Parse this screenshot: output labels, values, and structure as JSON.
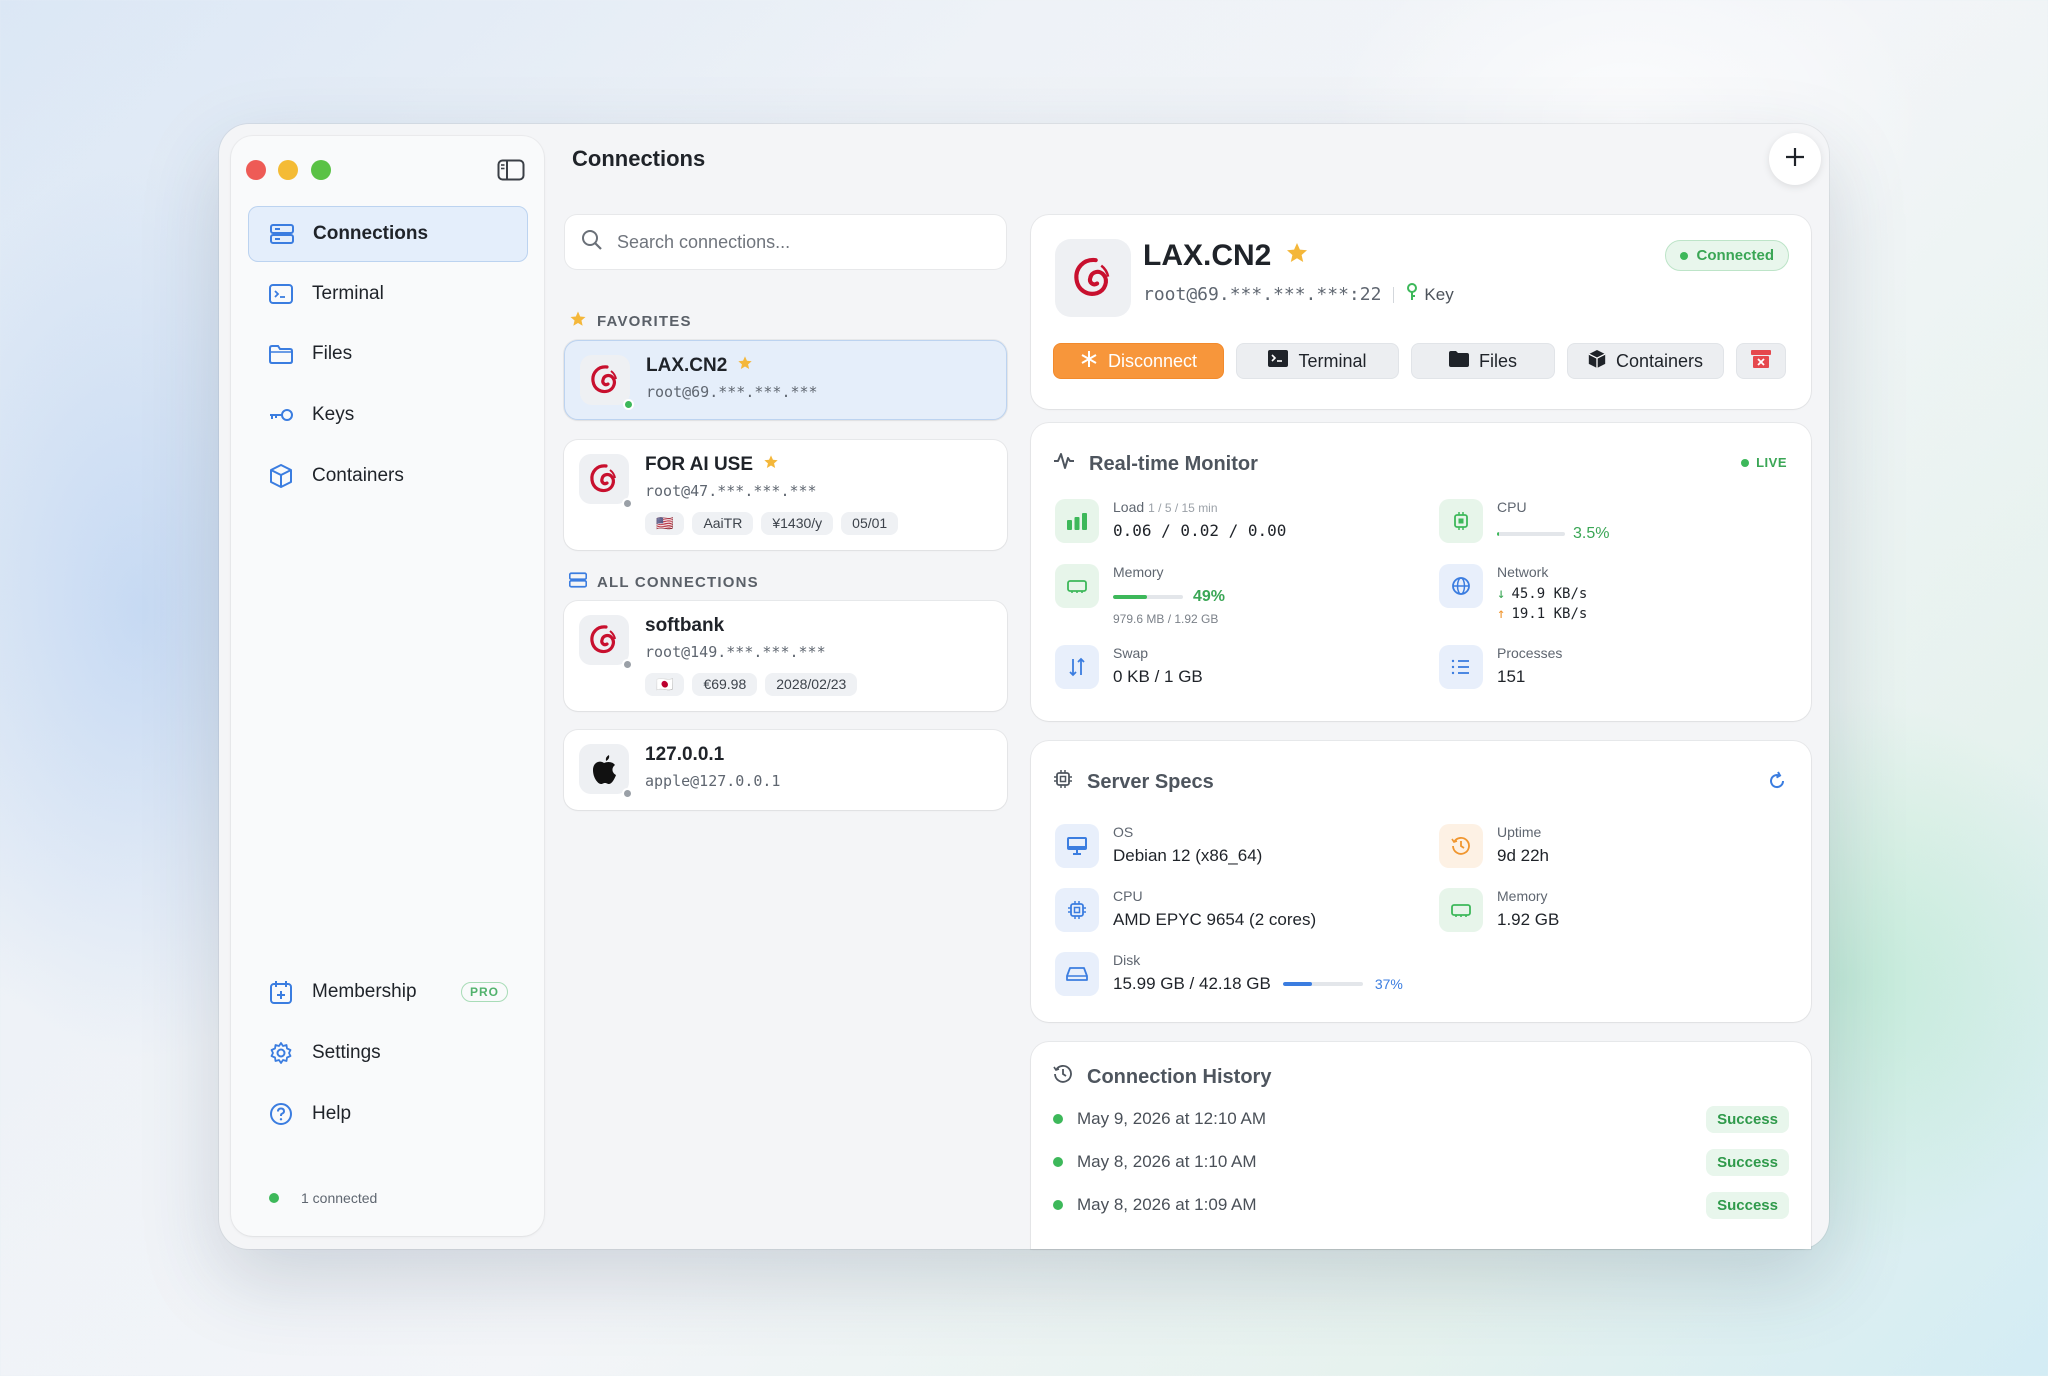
{
  "sidebar": {
    "items": [
      {
        "label": "Connections",
        "icon": "server-icon"
      },
      {
        "label": "Terminal",
        "icon": "terminal-icon"
      },
      {
        "label": "Files",
        "icon": "folder-icon"
      },
      {
        "label": "Keys",
        "icon": "key-icon"
      },
      {
        "label": "Containers",
        "icon": "cube-icon"
      }
    ],
    "bottom_items": [
      {
        "label": "Membership",
        "icon": "membership-icon",
        "badge": "PRO"
      },
      {
        "label": "Settings",
        "icon": "gear-icon"
      },
      {
        "label": "Help",
        "icon": "help-icon"
      }
    ],
    "status": "1 connected"
  },
  "header": {
    "title": "Connections"
  },
  "search": {
    "placeholder": "Search connections..."
  },
  "favorites": {
    "label": "FAVORITES",
    "items": [
      {
        "name": "LAX.CN2",
        "host": "root@69.***.***.***",
        "status": "online"
      },
      {
        "name": "FOR AI USE",
        "host": "root@47.***.***.***",
        "status": "offline",
        "tags": [
          "🇺🇸",
          "AaiTR",
          "¥1430/y",
          "05/01"
        ]
      }
    ]
  },
  "all_connections": {
    "label": "ALL CONNECTIONS",
    "items": [
      {
        "name": "softbank",
        "host": "root@149.***.***.***",
        "status": "offline",
        "tags": [
          "🇯🇵",
          "€69.98",
          "2028/02/23"
        ]
      },
      {
        "name": "127.0.0.1",
        "host": "apple@127.0.0.1",
        "status": "offline"
      }
    ]
  },
  "detail": {
    "name": "LAX.CN2",
    "host": "root@69.***.***.***:22",
    "auth": "Key",
    "status": "Connected",
    "actions": {
      "disconnect": "Disconnect",
      "terminal": "Terminal",
      "files": "Files",
      "containers": "Containers"
    }
  },
  "monitor": {
    "title": "Real-time Monitor",
    "live": "LIVE",
    "load_label": "Load",
    "load_sub": "1 / 5 / 15 min",
    "load_value": "0.06 / 0.02 / 0.00",
    "cpu_label": "CPU",
    "cpu_value": "3.5%",
    "cpu_fraction": 0.035,
    "memory_label": "Memory",
    "memory_value": "49%",
    "memory_fraction": 0.49,
    "memory_detail": "979.6 MB / 1.92 GB",
    "network_label": "Network",
    "network_down": "45.9 KB/s",
    "network_up": "19.1 KB/s",
    "swap_label": "Swap",
    "swap_value": "0 KB / 1 GB",
    "processes_label": "Processes",
    "processes_value": "151"
  },
  "specs": {
    "title": "Server Specs",
    "os_label": "OS",
    "os_value": "Debian 12 (x86_64)",
    "uptime_label": "Uptime",
    "uptime_value": "9d 22h",
    "cpu_label": "CPU",
    "cpu_value": "AMD EPYC 9654 (2 cores)",
    "memory_label": "Memory",
    "memory_value": "1.92 GB",
    "disk_label": "Disk",
    "disk_value": "15.99 GB / 42.18 GB",
    "disk_percent": "37%",
    "disk_fraction": 0.37
  },
  "history": {
    "title": "Connection History",
    "items": [
      {
        "when": "May 9, 2026 at 12:10 AM",
        "result": "Success"
      },
      {
        "when": "May 8, 2026 at 1:10 AM",
        "result": "Success"
      },
      {
        "when": "May 8, 2026 at 1:09 AM",
        "result": "Success"
      }
    ]
  },
  "colors": {
    "accent": "#f7963b",
    "success": "#3db85a",
    "primary": "#3b7de0"
  }
}
